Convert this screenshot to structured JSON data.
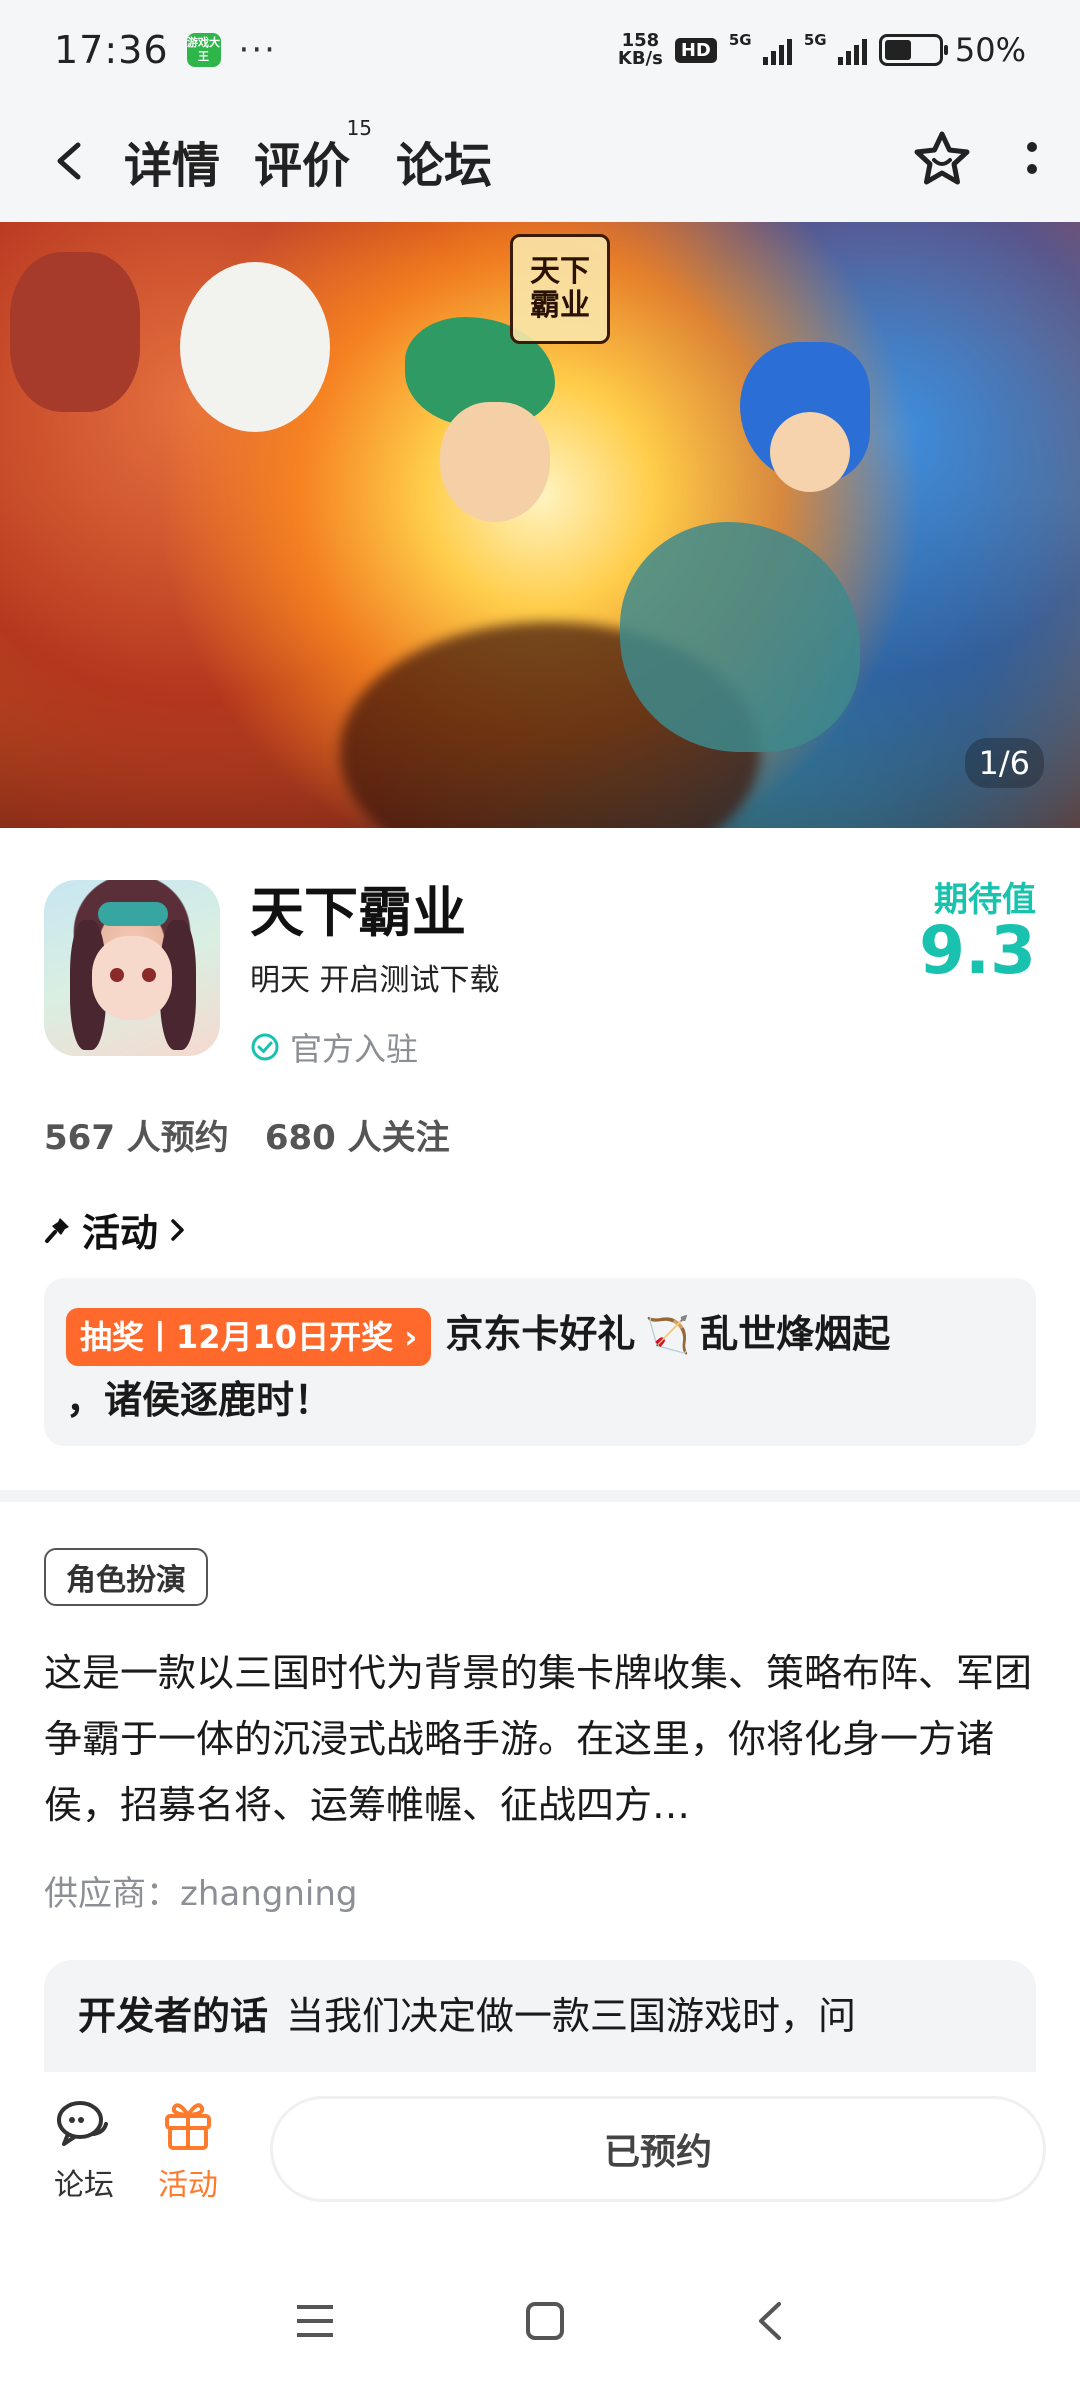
{
  "status_bar": {
    "time": "17:36",
    "app_icon_text": "游戏大王",
    "more": "···",
    "net_speed_value": "158",
    "net_speed_unit": "KB/s",
    "hd": "HD",
    "signal1": "5G",
    "signal2": "5G",
    "battery_pct": "50%"
  },
  "header": {
    "tabs": [
      {
        "label": "详情",
        "active": true
      },
      {
        "label": "评价",
        "count": "15"
      },
      {
        "label": "论坛"
      }
    ],
    "icons": [
      "back-icon",
      "star-icon",
      "more-vertical-icon"
    ]
  },
  "banner": {
    "logo_text_1": "天下",
    "logo_text_2": "霸业",
    "page_indicator": "1/6"
  },
  "app": {
    "name": "天下霸业",
    "subtitle": "明天 开启测试下载",
    "official": "官方入驻",
    "expect_label": "期待值",
    "expect_score": "9.3",
    "reservations": "567 人预约",
    "followers": "680 人关注"
  },
  "activity": {
    "title": "活动",
    "tag": "抽奖丨12月10日开奖",
    "text_1": "京东卡好礼",
    "text_2": "乱世烽烟起",
    "text_3": "，诸侯逐鹿时！"
  },
  "details": {
    "genre": "角色扮演",
    "description": "这是一款以三国时代为背景的集卡牌收集、策略布阵、军团争霸于一体的沉浸式战略手游。在这里，你将化身一方诸侯，招募名将、运筹帷幄、征战四方…",
    "supplier": "供应商：zhangning",
    "dev_label": "开发者的话",
    "dev_text": "当我们决定做一款三国游戏时，问"
  },
  "bottom_bar": {
    "forum_label": "论坛",
    "activity_label": "活动",
    "reserve_label": "已预约"
  },
  "colors": {
    "accent": "#18c2ae",
    "orange": "#ff6a2c",
    "text": "#1a1a1a",
    "muted": "#8c9096"
  }
}
